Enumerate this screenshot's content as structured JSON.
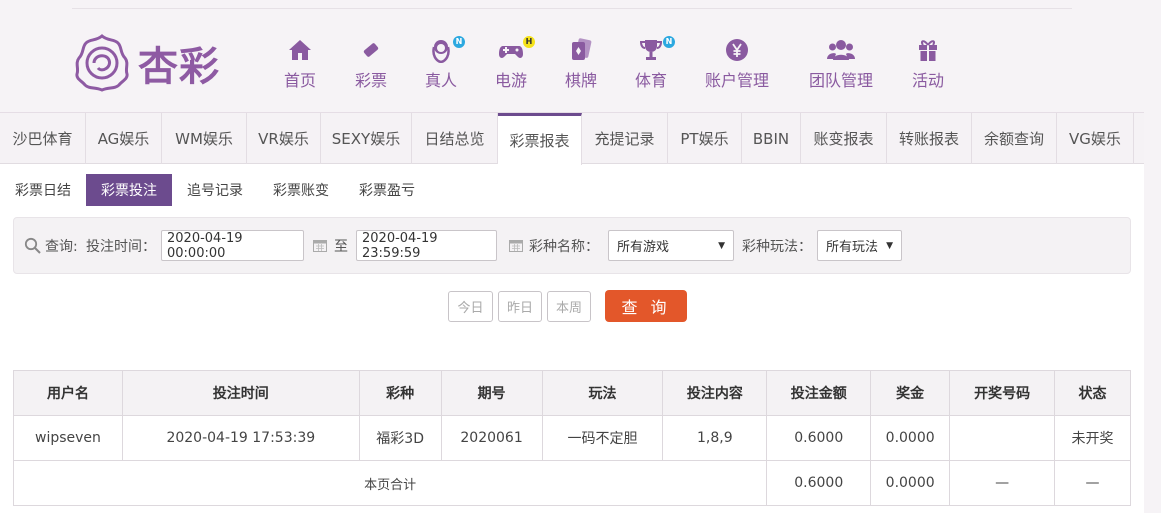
{
  "brand": {
    "name": "杏彩"
  },
  "nav": [
    {
      "label": "首页",
      "icon": "home-icon",
      "badge": ""
    },
    {
      "label": "彩票",
      "icon": "ticket-icon",
      "badge": ""
    },
    {
      "label": "真人",
      "icon": "dealer-icon",
      "badge": "N"
    },
    {
      "label": "电游",
      "icon": "gamepad-icon",
      "badge": "H"
    },
    {
      "label": "棋牌",
      "icon": "cards-icon",
      "badge": ""
    },
    {
      "label": "体育",
      "icon": "trophy-icon",
      "badge": "N"
    },
    {
      "label": "账户管理",
      "icon": "yen-icon",
      "badge": ""
    },
    {
      "label": "团队管理",
      "icon": "team-icon",
      "badge": ""
    },
    {
      "label": "活动",
      "icon": "gift-icon",
      "badge": ""
    }
  ],
  "tabs": [
    "沙巴体育",
    "AG娱乐",
    "WM娱乐",
    "VR娱乐",
    "SEXY娱乐",
    "日结总览",
    "彩票报表",
    "充提记录",
    "PT娱乐",
    "BBIN",
    "账变报表",
    "转账报表",
    "余额查询",
    "VG娱乐"
  ],
  "active_tab": "彩票报表",
  "subtabs": [
    "彩票日结",
    "彩票投注",
    "追号记录",
    "彩票账变",
    "彩票盈亏"
  ],
  "active_subtab": "彩票投注",
  "query": {
    "label": "查询:",
    "time_label": "投注时间：",
    "start": "2020-04-19 00:00:00",
    "to": "至",
    "end": "2020-04-19 23:59:59",
    "lottery_label": "彩种名称：",
    "lottery_value": "所有游戏",
    "play_label": "彩种玩法：",
    "play_value": "所有玩法"
  },
  "quick_buttons": [
    "今日",
    "昨日",
    "本周"
  ],
  "submit_label": "查 询",
  "table": {
    "headers": [
      "用户名",
      "投注时间",
      "彩种",
      "期号",
      "玩法",
      "投注内容",
      "投注金额",
      "奖金",
      "开奖号码",
      "状态"
    ],
    "rows": [
      [
        "wipseven",
        "2020-04-19 17:53:39",
        "福彩3D",
        "2020061",
        "一码不定胆",
        "1,8,9",
        "0.6000",
        "0.0000",
        "",
        "未开奖"
      ]
    ],
    "summary": {
      "label": "本页合计",
      "amount": "0.6000",
      "bonus": "0.0000",
      "draw": "—",
      "status": "—"
    }
  },
  "colors": {
    "accent": "#6c4b8e",
    "nav_text": "#8a5aa0",
    "query_button": "#e3572a",
    "status_pending": "#1e8a1e"
  }
}
